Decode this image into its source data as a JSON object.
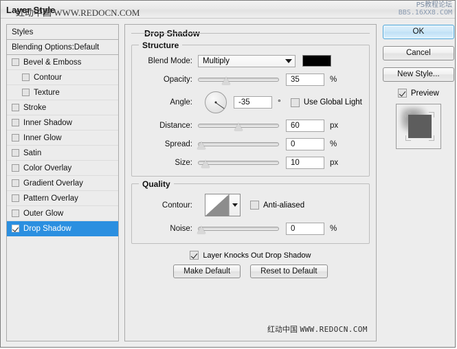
{
  "window": {
    "title": "Layer Style",
    "watermark_title": "红动中国 WWW.REDOCN.COM",
    "watermark_topright_line1": "PS教程论坛",
    "watermark_topright_line2": "BBS.16XX8.COM",
    "watermark_bottom_cn": "红动中国",
    "watermark_bottom_en": "WWW.REDOCN.COM"
  },
  "styles_panel": {
    "header": "Styles",
    "blending_options": "Blending Options:Default",
    "effects": [
      {
        "label": "Bevel & Emboss",
        "checked": false,
        "indent": false,
        "selected": false
      },
      {
        "label": "Contour",
        "checked": false,
        "indent": true,
        "selected": false
      },
      {
        "label": "Texture",
        "checked": false,
        "indent": true,
        "selected": false
      },
      {
        "label": "Stroke",
        "checked": false,
        "indent": false,
        "selected": false
      },
      {
        "label": "Inner Shadow",
        "checked": false,
        "indent": false,
        "selected": false
      },
      {
        "label": "Inner Glow",
        "checked": false,
        "indent": false,
        "selected": false
      },
      {
        "label": "Satin",
        "checked": false,
        "indent": false,
        "selected": false
      },
      {
        "label": "Color Overlay",
        "checked": false,
        "indent": false,
        "selected": false
      },
      {
        "label": "Gradient Overlay",
        "checked": false,
        "indent": false,
        "selected": false
      },
      {
        "label": "Pattern Overlay",
        "checked": false,
        "indent": false,
        "selected": false
      },
      {
        "label": "Outer Glow",
        "checked": false,
        "indent": false,
        "selected": false
      },
      {
        "label": "Drop Shadow",
        "checked": true,
        "indent": false,
        "selected": true
      }
    ]
  },
  "main": {
    "panel_title": "Drop Shadow",
    "structure": {
      "title": "Structure",
      "blend_mode_label": "Blend Mode:",
      "blend_mode_value": "Multiply",
      "shadow_color": "#000000",
      "opacity_label": "Opacity:",
      "opacity_value": "35",
      "opacity_unit": "%",
      "angle_label": "Angle:",
      "angle_value": "-35",
      "angle_unit": "°",
      "use_global_light_label": "Use Global Light",
      "use_global_light_checked": false,
      "distance_label": "Distance:",
      "distance_value": "60",
      "distance_unit": "px",
      "spread_label": "Spread:",
      "spread_value": "0",
      "spread_unit": "%",
      "size_label": "Size:",
      "size_value": "10",
      "size_unit": "px"
    },
    "quality": {
      "title": "Quality",
      "contour_label": "Contour:",
      "anti_aliased_label": "Anti-aliased",
      "anti_aliased_checked": false,
      "noise_label": "Noise:",
      "noise_value": "0",
      "noise_unit": "%"
    },
    "knocks_out_label": "Layer Knocks Out Drop Shadow",
    "knocks_out_checked": true,
    "make_default_label": "Make Default",
    "reset_default_label": "Reset to Default"
  },
  "right": {
    "ok_label": "OK",
    "cancel_label": "Cancel",
    "new_style_label": "New Style...",
    "preview_label": "Preview",
    "preview_checked": true
  },
  "colors": {
    "accent": "#2b8fe0",
    "dialog_bg": "#ececec",
    "primary_button_border": "#4aa3d8"
  },
  "sliders": {
    "opacity_pct": 35,
    "distance_pct": 50,
    "spread_pct": 3,
    "size_pct": 8,
    "noise_pct": 3
  }
}
